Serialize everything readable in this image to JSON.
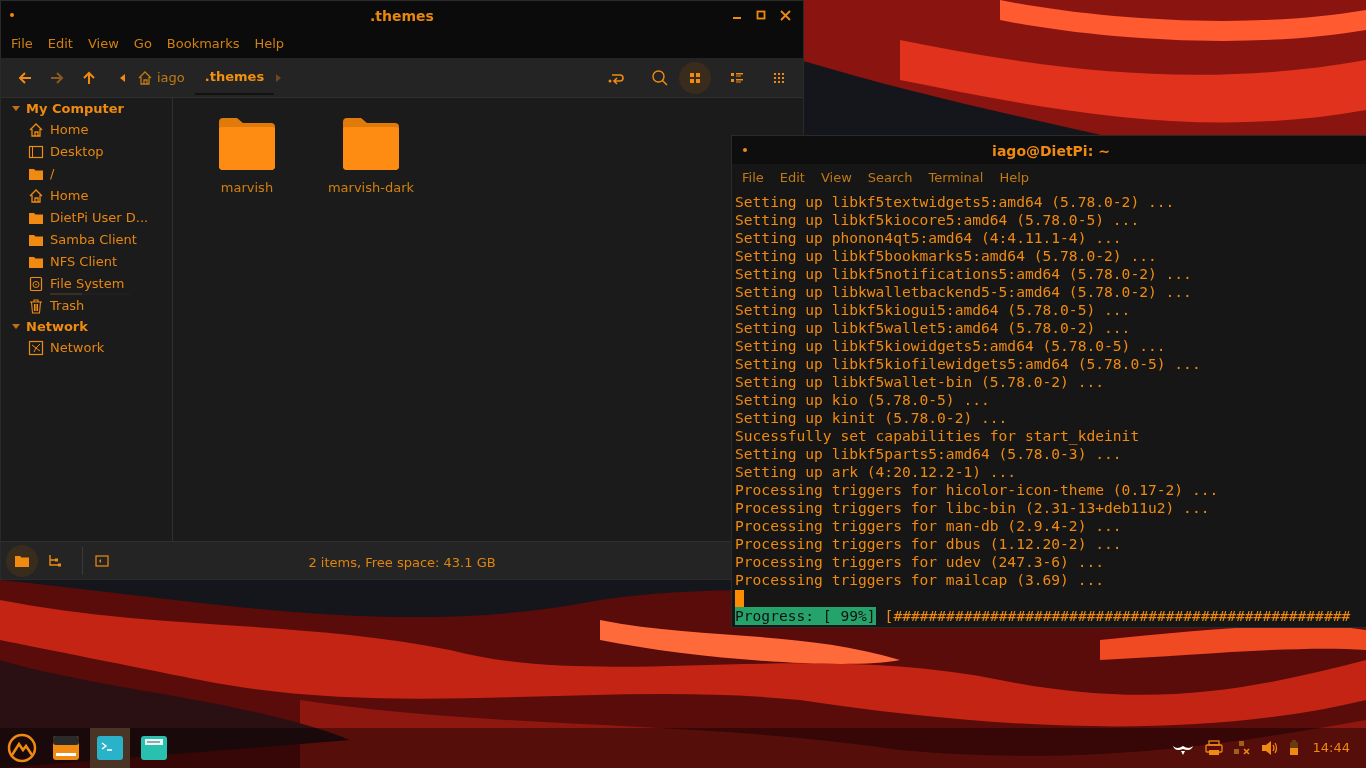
{
  "file_manager": {
    "title": ".themes",
    "menu": [
      "File",
      "Edit",
      "View",
      "Go",
      "Bookmarks",
      "Help"
    ],
    "nav_buttons": [
      {
        "kind": "back",
        "disabled": false
      },
      {
        "kind": "forward",
        "disabled": true
      },
      {
        "kind": "up",
        "disabled": false
      }
    ],
    "breadcrumb": [
      {
        "label": "iago",
        "kind": "home",
        "selected": false
      },
      {
        "label": ".themes",
        "kind": "folder",
        "selected": true
      }
    ],
    "view_buttons": [
      {
        "kind": "icons",
        "selected": true
      },
      {
        "kind": "list",
        "selected": false
      },
      {
        "kind": "compact",
        "selected": false
      }
    ],
    "sidebar": [
      {
        "label": "My Computer",
        "expanded": true,
        "items": [
          {
            "label": "Home",
            "kind": "home"
          },
          {
            "label": "Desktop",
            "kind": "desktop"
          },
          {
            "label": "/",
            "kind": "folder"
          },
          {
            "label": "Home",
            "kind": "home"
          },
          {
            "label": "DietPi User D...",
            "kind": "folder"
          },
          {
            "label": "Samba Client",
            "kind": "folder"
          },
          {
            "label": "NFS Client",
            "kind": "folder"
          },
          {
            "label": "File System",
            "kind": "drive",
            "level": 0.4
          },
          {
            "label": "Trash",
            "kind": "trash"
          }
        ]
      },
      {
        "label": "Network",
        "expanded": true,
        "items": [
          {
            "label": "Network",
            "kind": "network"
          }
        ]
      }
    ],
    "files": [
      {
        "name": "marvish"
      },
      {
        "name": "marvish-dark"
      }
    ],
    "status_bar": {
      "text": "2 items, Free space: 43.1 GB",
      "pane_buttons": [
        {
          "kind": "places",
          "selected": true
        },
        {
          "kind": "tree",
          "selected": false
        }
      ]
    }
  },
  "terminal": {
    "title": "iago@DietPi: ~",
    "menu": [
      "File",
      "Edit",
      "View",
      "Search",
      "Terminal",
      "Help"
    ],
    "lines": [
      "Setting up libkf5textwidgets5:amd64 (5.78.0-2) ...",
      "Setting up libkf5kiocore5:amd64 (5.78.0-5) ...",
      "Setting up phonon4qt5:amd64 (4:4.11.1-4) ...",
      "Setting up libkf5bookmarks5:amd64 (5.78.0-2) ...",
      "Setting up libkf5notifications5:amd64 (5.78.0-2) ...",
      "Setting up libkwalletbackend5-5:amd64 (5.78.0-2) ...",
      "Setting up libkf5kiogui5:amd64 (5.78.0-5) ...",
      "Setting up libkf5wallet5:amd64 (5.78.0-2) ...",
      "Setting up libkf5kiowidgets5:amd64 (5.78.0-5) ...",
      "Setting up libkf5kiofilewidgets5:amd64 (5.78.0-5) ...",
      "Setting up libkf5wallet-bin (5.78.0-2) ...",
      "Setting up kio (5.78.0-5) ...",
      "Setting up kinit (5.78.0-2) ...",
      "Sucessfully set capabilities for start_kdeinit",
      "Setting up libkf5parts5:amd64 (5.78.0-3) ...",
      "Setting up ark (4:20.12.2-1) ...",
      "Processing triggers for hicolor-icon-theme (0.17-2) ...",
      "Processing triggers for libc-bin (2.31-13+deb11u2) ...",
      "Processing triggers for man-db (2.9.4-2) ...",
      "Processing triggers for dbus (1.12.20-2) ...",
      "Processing triggers for udev (247.3-6) ...",
      "Processing triggers for mailcap (3.69) ..."
    ],
    "progress_label": "Progress: [ 99%]",
    "progress_bar": "[####################################################"
  },
  "taskbar": {
    "apps": [
      {
        "kind": "menu",
        "active": false
      },
      {
        "kind": "files",
        "active": false
      },
      {
        "kind": "terminal",
        "active": true
      },
      {
        "kind": "editor",
        "active": false
      }
    ],
    "tray": [
      {
        "kind": "mustache"
      },
      {
        "kind": "printer"
      },
      {
        "kind": "network"
      },
      {
        "kind": "volume"
      },
      {
        "kind": "battery"
      }
    ],
    "clock": "14:44"
  }
}
